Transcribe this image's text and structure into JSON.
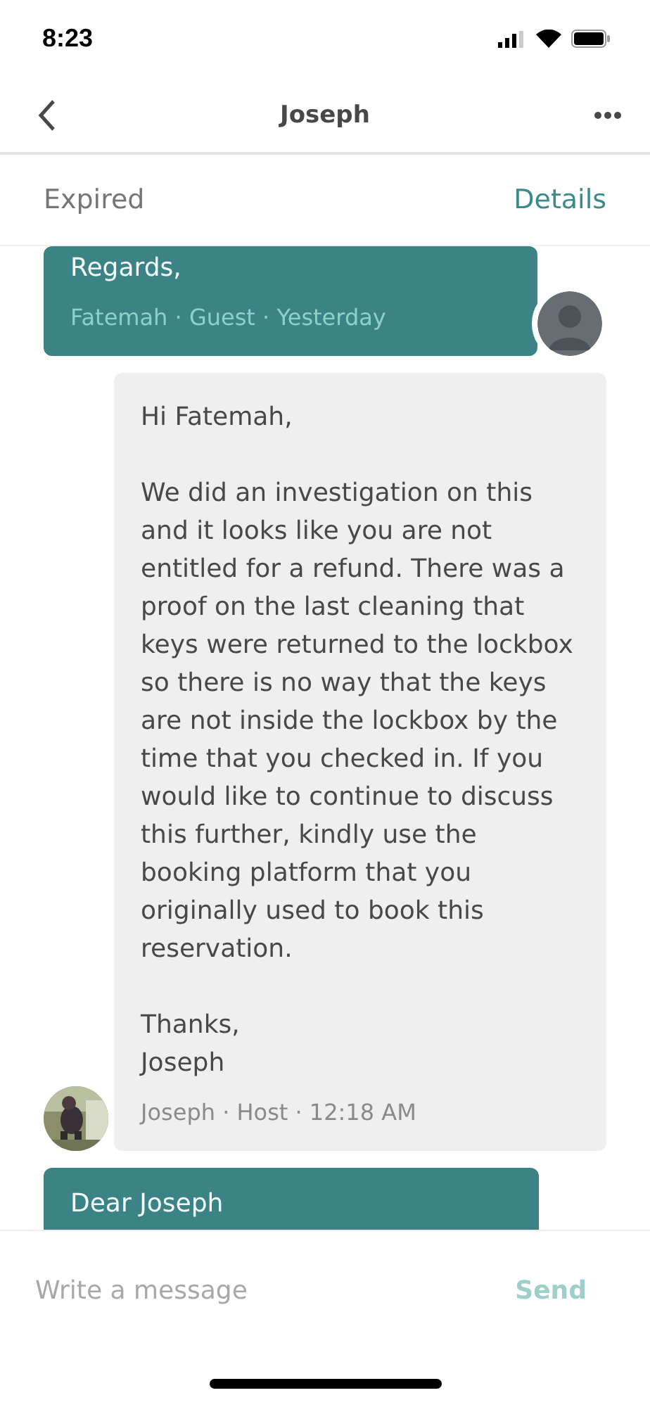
{
  "status_bar": {
    "time": "8:23"
  },
  "nav": {
    "title": "Joseph"
  },
  "subheader": {
    "status": "Expired",
    "link": "Details"
  },
  "messages": [
    {
      "kind": "sent",
      "paragraphs": [
        "Regards,"
      ],
      "meta": "Fatemah · Guest · Yesterday",
      "avatar": {
        "kind": "silhouette"
      }
    },
    {
      "kind": "received",
      "paragraphs": [
        "Hi Fatemah,",
        "We did an investigation on this and it looks like you are not entitled for a refund. There was a proof on the last cleaning that keys were returned to the lockbox so there is no way that the keys are not inside the lockbox by the time that you checked in. If you would like to continue to discuss this further, kindly use the booking platform that you originally used to book this reservation.",
        "Thanks,\nJoseph"
      ],
      "meta": "Joseph · Host · 12:18 AM"
    },
    {
      "kind": "sent",
      "paragraphs": [
        "Dear Joseph"
      ]
    }
  ],
  "composer": {
    "placeholder": "Write a message",
    "send": "Send"
  }
}
